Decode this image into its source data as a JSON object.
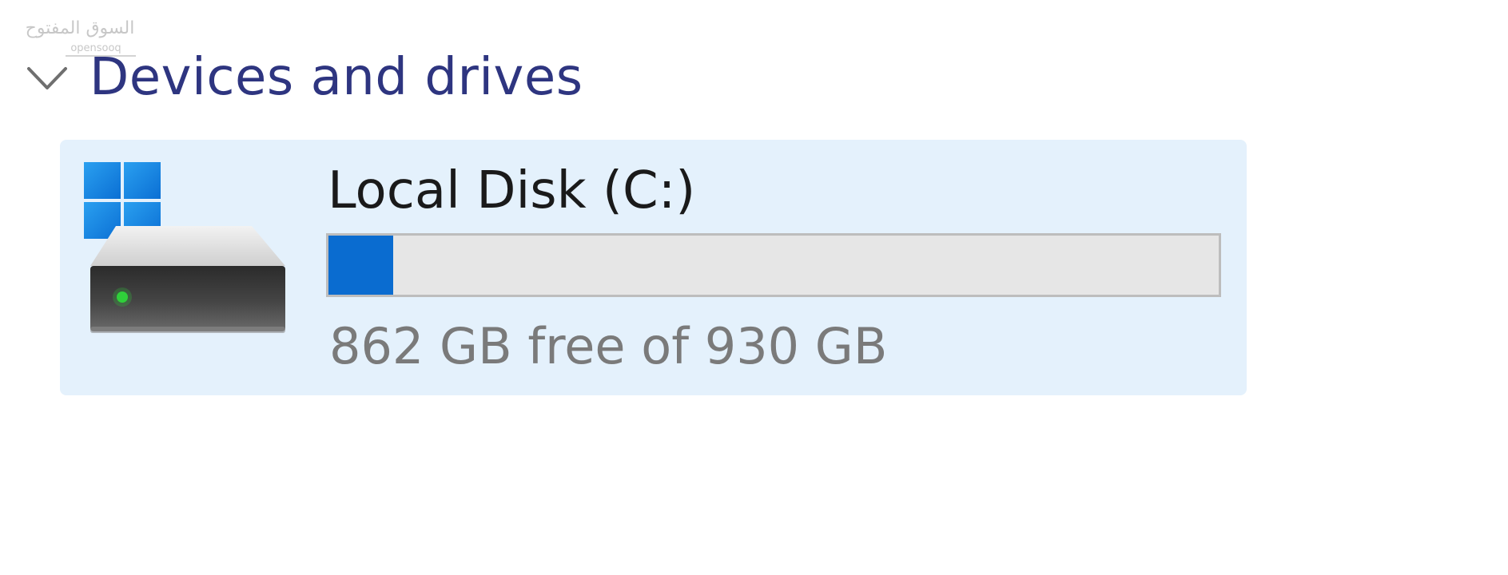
{
  "watermark": {
    "text": "السوق المفتوح",
    "subtext": "opensooq"
  },
  "group": {
    "title": "Devices and drives",
    "expanded": true,
    "chevron_icon": "chevron-down-icon"
  },
  "drives": [
    {
      "name": "Local Disk (C:)",
      "free_text": "862 GB free of 930 GB",
      "used_fraction": 0.073,
      "icon": "windows-drive-icon",
      "selected": true
    }
  ],
  "colors": {
    "group_title": "#2e3580",
    "tile_background": "#e4f1fc",
    "usage_fill": "#0a6cd0",
    "usage_track": "#e6e6e6",
    "free_text": "#7a7a7a"
  }
}
